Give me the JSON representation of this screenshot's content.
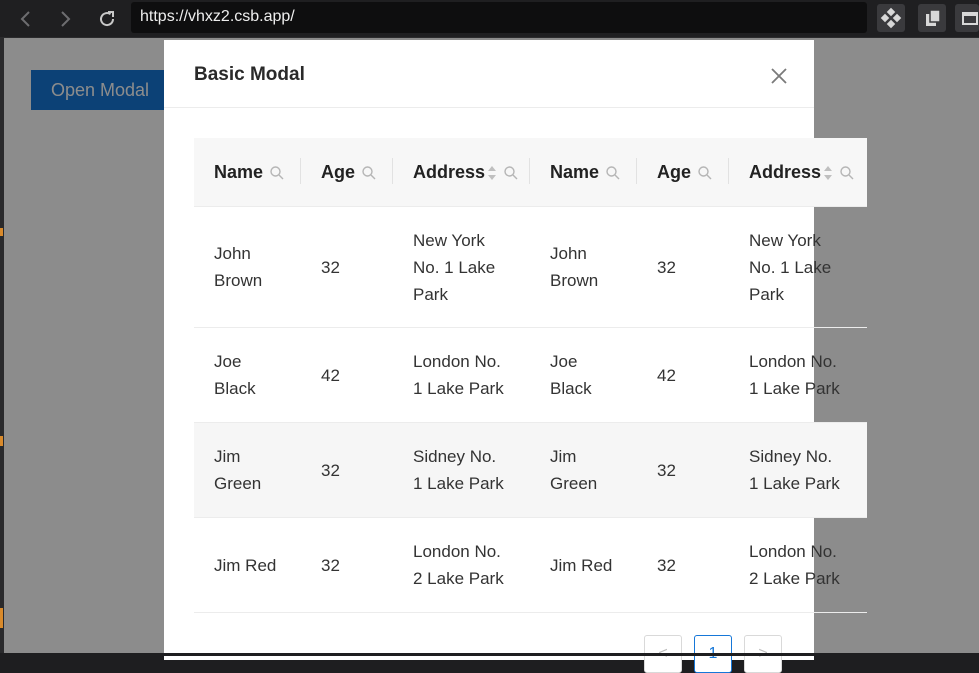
{
  "browser": {
    "url": "https://vhxz2.csb.app/"
  },
  "page": {
    "open_modal_label": "Open Modal"
  },
  "modal": {
    "title": "Basic Modal",
    "columns": [
      "Name",
      "Age",
      "Address",
      "Name",
      "Age",
      "Address"
    ],
    "rows": [
      [
        "John\nBrown",
        "32",
        "New York\nNo. 1 Lake\nPark",
        "John\nBrown",
        "32",
        "New York\nNo. 1 Lake\nPark"
      ],
      [
        "Joe\nBlack",
        "42",
        "London No.\n1 Lake Park",
        "Joe\nBlack",
        "42",
        "London No.\n1 Lake Park"
      ],
      [
        "Jim\nGreen",
        "32",
        "Sidney No.\n1 Lake Park",
        "Jim\nGreen",
        "32",
        "Sidney No.\n1 Lake Park"
      ],
      [
        "Jim Red",
        "32",
        "London No.\n2 Lake Park",
        "Jim Red",
        "32",
        "London No.\n2 Lake Park"
      ]
    ],
    "pagination": {
      "prev": "<",
      "current": "1",
      "next": ">"
    }
  },
  "colors": {
    "accent": "#1677d8",
    "header_bg": "#f7f7f7",
    "hover_row_bg": "#f6f6f6"
  }
}
